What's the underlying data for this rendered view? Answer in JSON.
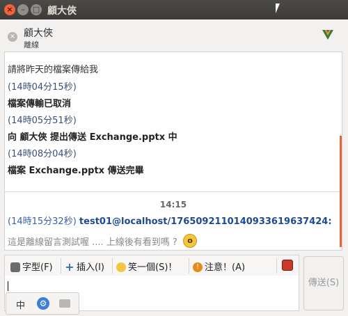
{
  "window": {
    "title": "顧大俠"
  },
  "header": {
    "contact_name": "顧大俠",
    "contact_status": "離線"
  },
  "chat": {
    "lines": [
      {
        "text": "請將昨天的檔案傳給我",
        "style": "normal"
      },
      {
        "text": "(14時04分15秒)",
        "style": "ts"
      },
      {
        "text": "檔案傳輸已取消",
        "style": "bold"
      },
      {
        "text": "(14時05分51秒)",
        "style": "ts"
      },
      {
        "text": "向 顧大俠 提出傳送 Exchange.pptx 中",
        "style": "bold"
      },
      {
        "text": "(14時08分04秒)",
        "style": "ts"
      },
      {
        "text": "檔案 Exchange.pptx 傳送完畢",
        "style": "bold"
      }
    ],
    "time_divider": "14:15",
    "message": {
      "timestamp": "(14時15分32秒)",
      "sender": "test01@localhost/17650921101409336196374​24:",
      "body": "這是離線留言測試喔 .... 上線後有看到嗎 ?"
    }
  },
  "toolbar": {
    "font_label": "字型(F)",
    "insert_label": "插入(I)",
    "smile_label": "笑一個(S)！",
    "attention_label": "注意！(A)"
  },
  "send_label": "傳送(S)",
  "ime": {
    "mode_label": "中"
  },
  "colors": {
    "accent": "#e8623a",
    "link": "#1e4a8f",
    "timestamp": "#3a5fa8"
  }
}
